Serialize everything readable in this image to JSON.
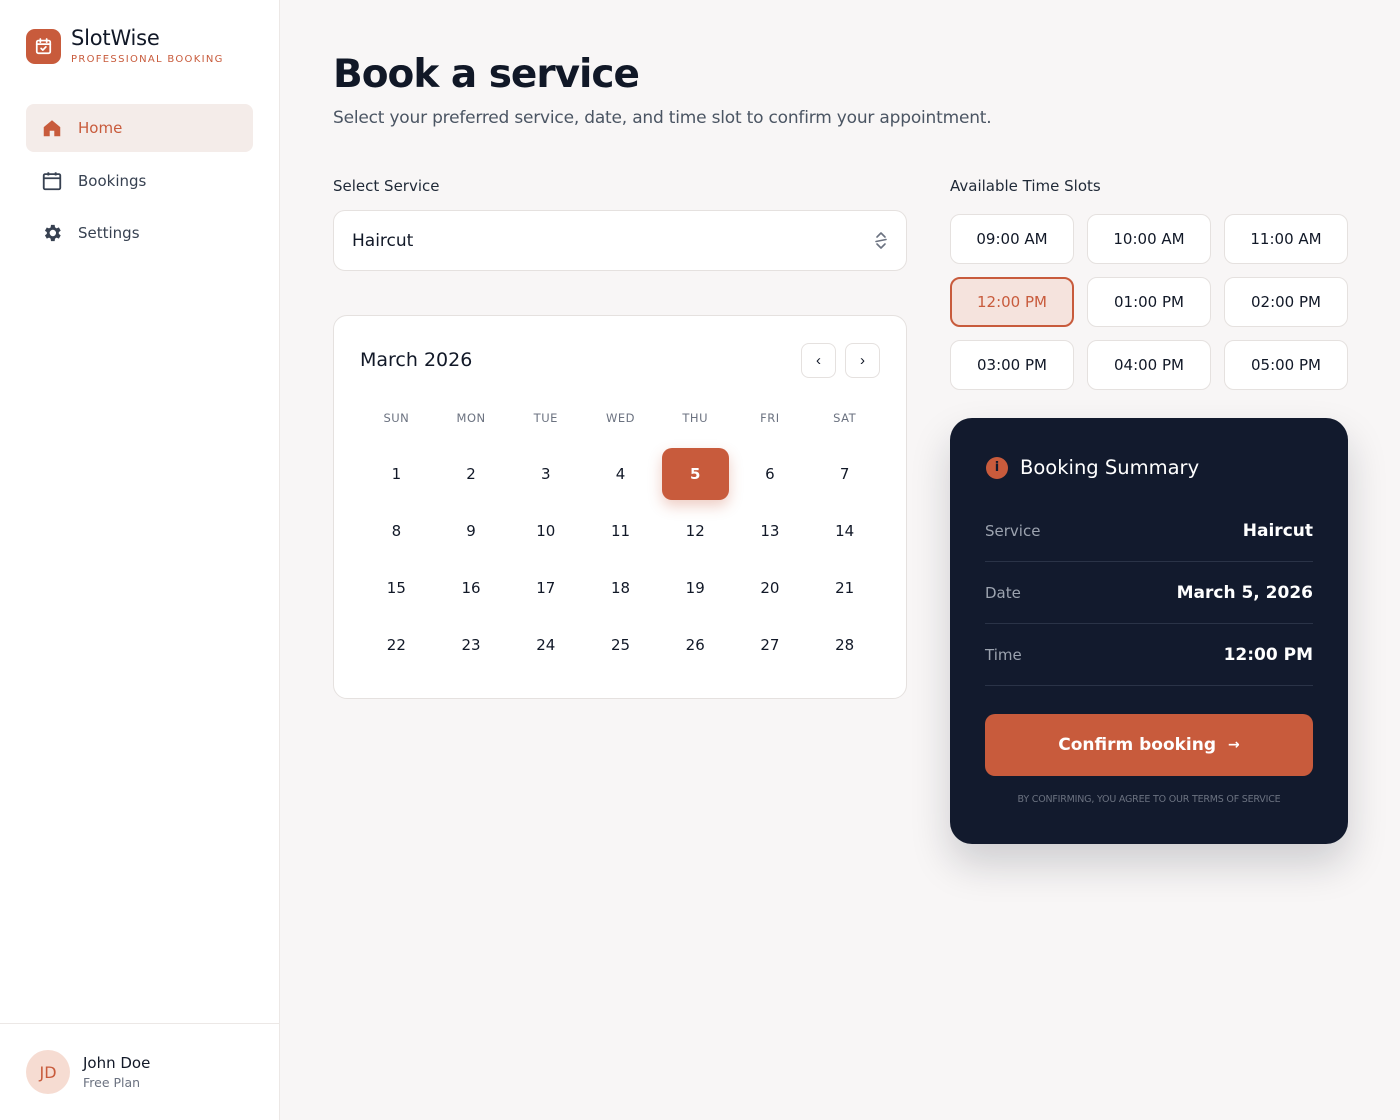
{
  "sidebar": {
    "brand_name": "SlotWise",
    "brand_tagline": "PROFESSIONAL BOOKING",
    "items": [
      {
        "label": "Home",
        "icon": "home-icon",
        "active": true
      },
      {
        "label": "Bookings",
        "icon": "calendar-icon",
        "active": false
      },
      {
        "label": "Settings",
        "icon": "gear-icon",
        "active": false
      }
    ],
    "user": {
      "initials": "JD",
      "name": "John Doe",
      "plan": "Free Plan"
    }
  },
  "page": {
    "title": "Book a service",
    "subtitle": "Select your preferred service, date, and time slot to confirm your appointment."
  },
  "service": {
    "label": "Select Service",
    "value": "Haircut"
  },
  "calendar": {
    "month": "March 2026",
    "prev_label": "‹",
    "next_label": "›",
    "weekdays": [
      "SUN",
      "MON",
      "TUE",
      "WED",
      "THU",
      "FRI",
      "SAT"
    ],
    "days": [
      "1",
      "2",
      "3",
      "4",
      "5",
      "6",
      "7",
      "8",
      "9",
      "10",
      "11",
      "12",
      "13",
      "14",
      "15",
      "16",
      "17",
      "18",
      "19",
      "20",
      "21",
      "22",
      "23",
      "24",
      "25",
      "26",
      "27",
      "28"
    ],
    "selected_day": "5"
  },
  "slots": {
    "label": "Available Time Slots",
    "items": [
      "09:00 AM",
      "10:00 AM",
      "11:00 AM",
      "12:00 PM",
      "01:00 PM",
      "02:00 PM",
      "03:00 PM",
      "04:00 PM",
      "05:00 PM"
    ],
    "selected": "12:00 PM"
  },
  "summary": {
    "title": "Booking Summary",
    "info_icon_glyph": "i",
    "rows": [
      {
        "label": "Service",
        "value": "Haircut"
      },
      {
        "label": "Date",
        "value": "March 5, 2026"
      },
      {
        "label": "Time",
        "value": "12:00 PM"
      }
    ],
    "confirm_label": "Confirm booking",
    "confirm_arrow": "→",
    "terms": "BY CONFIRMING, YOU AGREE TO OUR TERMS OF SERVICE"
  },
  "colors": {
    "accent": "#c85b3c",
    "accent_soft": "#f5e3dd",
    "dark_panel": "#121a2d",
    "background": "#f8f6f6"
  }
}
